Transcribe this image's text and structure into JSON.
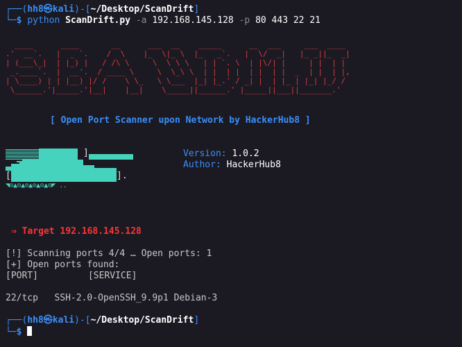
{
  "prompt": {
    "user": "hh8",
    "skull_icon": "kali-skull-icon",
    "host": "kali",
    "path": "~/Desktop/ScanDrift",
    "prefix_top": "┌──(",
    "sep": ")-[",
    "close": "]",
    "prefix_bottom": "└─",
    "dollar": "$"
  },
  "command": {
    "program": "python",
    "script": "ScanDrift.py",
    "flag_a": "-a",
    "ip": "192.168.145.128",
    "flag_p": "-p",
    "ports": "80 443 22 21"
  },
  "banner": {
    "ascii": "  ____      ____       __      ___  __    _____      __  ___     ___  ____\n.'  __`.   |  _ `.    /  \\    |_  \\|_ \\  |_   _`.   |  \\/  _|   |_ _||_  _|\n| (___\\_|  | |_) |   / /\\ \\     \\  \\ \\ \\   | | `. \\  | |\\/| |     | |  | |\n _.____`.  |  __'.  / ____ \\     \\  \\_\\ \\  | |  | |  | |  | |  _  | |  | |,\n| \\____) | | |__) |/ /    \\ \\_   \\ \\___  |_| |_.' / _| |  | |_ | |_| |_/ /\n \\______.'|_____.'|__|    |__|    \\_____||______.' |_____||___||_______.'",
    "tagline": "[ Open Port Scanner upon Network by HackerHub8 ]"
  },
  "info": {
    "version_label": "Version:",
    "version_value": "1.0.2",
    "author_label": "Author:",
    "author_value": "HackerHub8"
  },
  "art": {
    "bracket_top": "]",
    "bracket_bottom_left": "[",
    "bracket_bottom_right": "].",
    "symbols": "◥⊙▲⊙▲⊙▲⊙▲⊙▲⊙◤ .."
  },
  "target": {
    "arrow": "⇒",
    "label": "Target 192.168.145.128"
  },
  "scan": {
    "progress_line": "[!] Scanning ports 4/4 … Open ports: 1",
    "found_line": "[+] Open ports found:",
    "col_port": "[PORT]",
    "col_service": "[SERVICE]",
    "rows": [
      {
        "port": "22/tcp",
        "service": "SSH-2.0-OpenSSH_9.9p1 Debian-3"
      }
    ]
  },
  "colors": {
    "background": "#1b1a23",
    "blue": "#3a8ff7",
    "red": "#ff3434",
    "teal": "#45d3bd"
  }
}
